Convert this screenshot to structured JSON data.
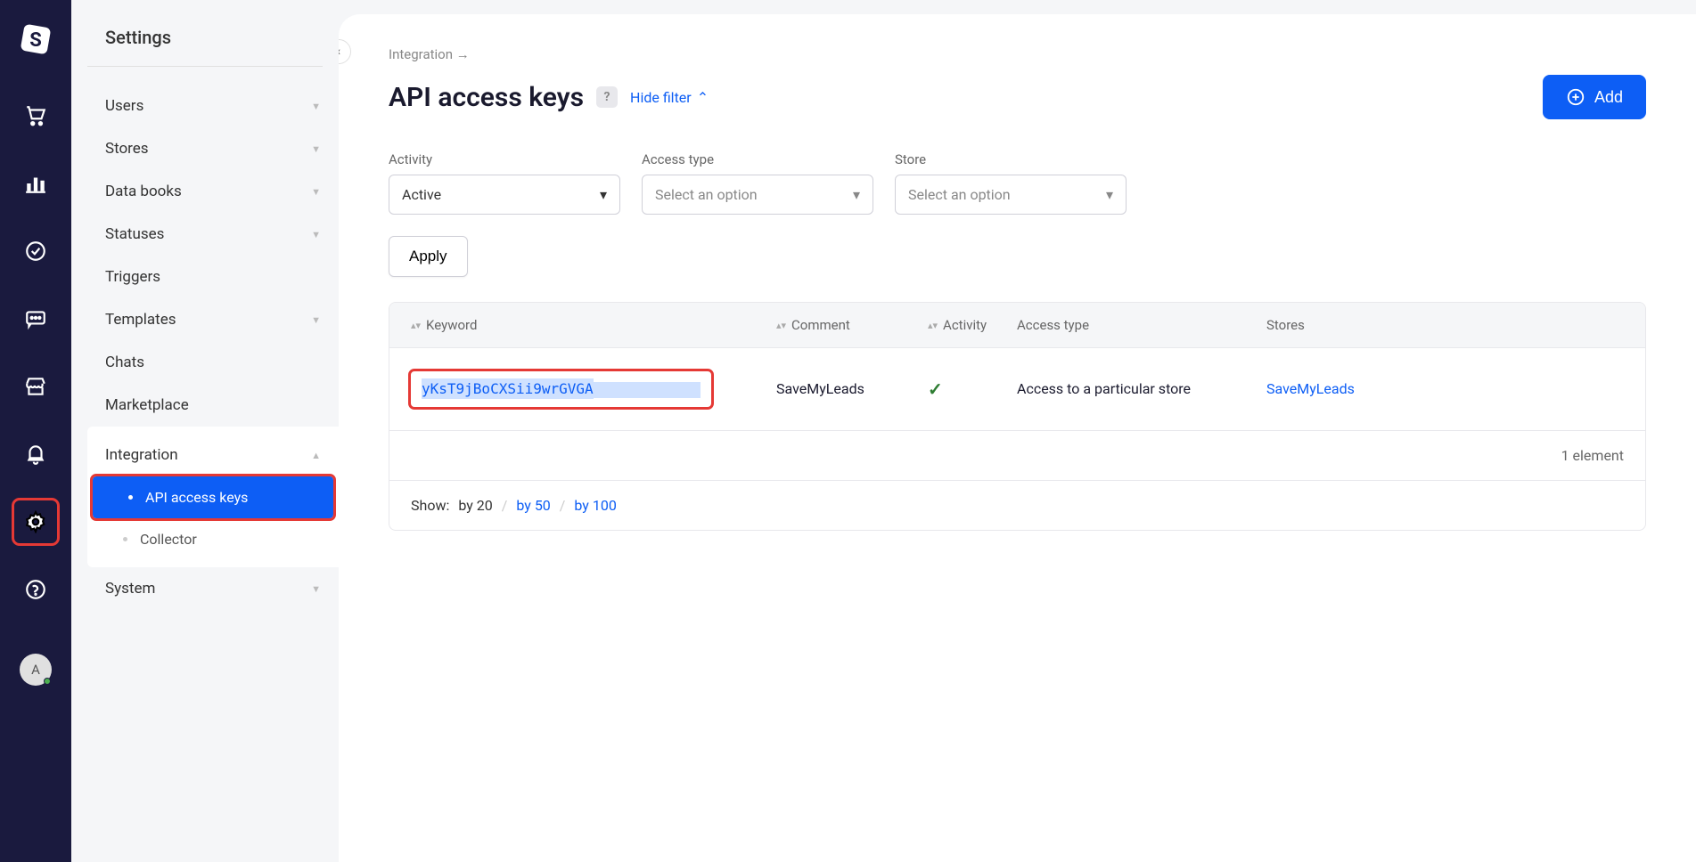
{
  "nav_rail": {
    "avatar_initial": "A"
  },
  "settings": {
    "title": "Settings",
    "groups": {
      "users": "Users",
      "stores": "Stores",
      "data_books": "Data books",
      "statuses": "Statuses",
      "triggers": "Triggers",
      "templates": "Templates",
      "chats": "Chats",
      "marketplace": "Marketplace",
      "integration": "Integration",
      "system": "System"
    },
    "integration_items": {
      "api_keys": "API access keys",
      "collector": "Collector"
    }
  },
  "breadcrumb": "Integration →",
  "page_title": "API access keys",
  "hide_filter": "Hide filter",
  "add_button": "Add",
  "filters": {
    "activity": {
      "label": "Activity",
      "value": "Active"
    },
    "access_type": {
      "label": "Access type",
      "placeholder": "Select an option"
    },
    "store": {
      "label": "Store",
      "placeholder": "Select an option"
    }
  },
  "apply": "Apply",
  "table": {
    "headers": {
      "keyword": "Keyword",
      "comment": "Comment",
      "activity": "Activity",
      "access_type": "Access type",
      "stores": "Stores"
    },
    "rows": [
      {
        "keyword": "yKsT9jBoCXSii9wrGVGA",
        "comment": "SaveMyLeads",
        "activity": true,
        "access_type": "Access to a particular store",
        "stores": "SaveMyLeads"
      }
    ],
    "footer": "1 element",
    "pager_label": "Show:",
    "pager": {
      "by20": "by 20",
      "by50": "by 50",
      "by100": "by 100"
    }
  }
}
